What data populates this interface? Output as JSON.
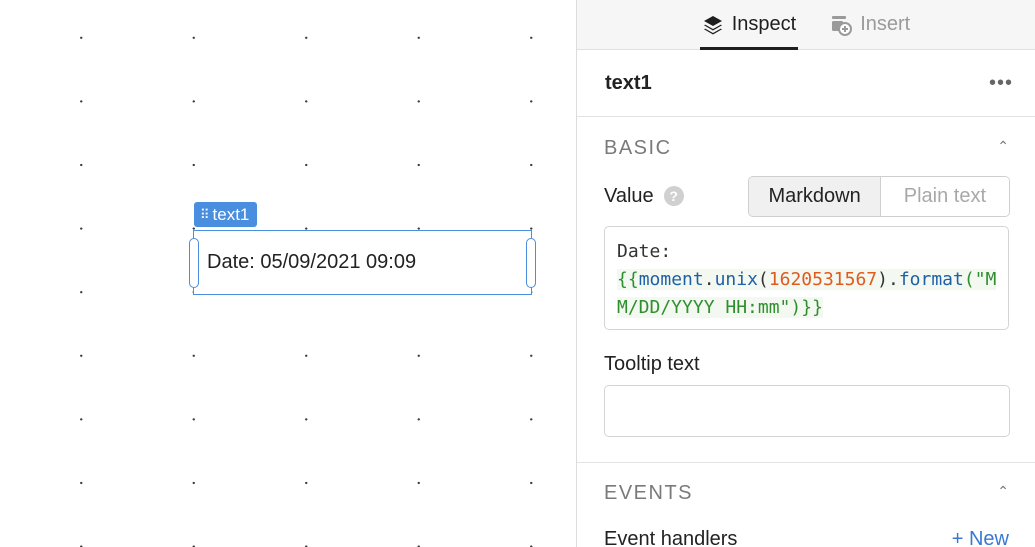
{
  "canvas": {
    "component_tag": "text1",
    "component_text": "Date: 05/09/2021 09:09"
  },
  "tabs": [
    {
      "label": "Inspect",
      "icon": "layers-icon",
      "active": true
    },
    {
      "label": "Insert",
      "icon": "insert-component-icon",
      "active": false
    }
  ],
  "inspector": {
    "component_name": "text1",
    "more_icon": "•••",
    "basic": {
      "title": "BASIC",
      "value_label": "Value",
      "help_icon": "?",
      "modes": {
        "markdown": "Markdown",
        "plain": "Plain text"
      },
      "code": {
        "line1": "Date:",
        "open": "{{",
        "moment": "moment",
        "dot1": ".",
        "unix": "unix",
        "paren_open": "(",
        "number": "1620531567",
        "paren_close": ")",
        "dot2": ".",
        "format": "format",
        "arg": "(\"M",
        "line3": "M/DD/YYYY HH:mm\")",
        "close": "}}"
      },
      "tooltip_label": "Tooltip text",
      "tooltip_value": ""
    },
    "events": {
      "title": "EVENTS",
      "handlers_label": "Event handlers",
      "new_link": "+ New"
    }
  },
  "colors": {
    "accent": "#4a8ee0",
    "link": "#3a78d6",
    "code_green": "#2f8f2f",
    "code_blue": "#1f5fa8",
    "code_orange": "#e05a1f"
  }
}
